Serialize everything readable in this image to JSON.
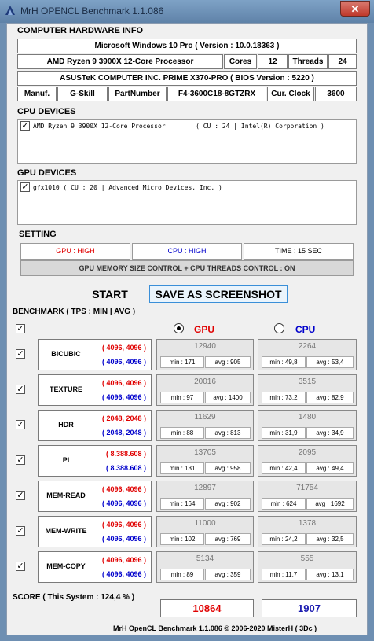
{
  "window": {
    "title": "MrH OPENCL Benchmark 1.1.086",
    "close_glyph": "✕"
  },
  "hardware": {
    "header": "COMPUTER HARDWARE INFO",
    "os": "Microsoft Windows 10 Pro ( Version : 10.0.18363 )",
    "cpu": "AMD Ryzen 9 3900X 12-Core Processor",
    "cores_label": "Cores",
    "cores_value": "12",
    "threads_label": "Threads",
    "threads_value": "24",
    "board": "ASUSTeK COMPUTER INC. PRIME X370-PRO ( BIOS Version : 5220 )",
    "manuf_label": "Manuf.",
    "manuf_value": "G-Skill",
    "part_label": "PartNumber",
    "part_value": "F4-3600C18-8GTZRX",
    "clock_label": "Cur. Clock",
    "clock_value": "3600"
  },
  "cpu_devices": {
    "header": "CPU DEVICES",
    "items": [
      "AMD Ryzen 9 3900X 12-Core Processor        ( CU : 24 | Intel(R) Corporation )"
    ]
  },
  "gpu_devices": {
    "header": "GPU DEVICES",
    "items": [
      "gfx1010 ( CU : 20 | Advanced Micro Devices, Inc. )"
    ]
  },
  "setting": {
    "header": "SETTING",
    "gpu": "GPU : HIGH",
    "cpu": "CPU : HIGH",
    "time": "TIME : 15 SEC",
    "memory": "GPU MEMORY SIZE CONTROL + CPU THREADS CONTROL : ON"
  },
  "buttons": {
    "start": "START",
    "save": "SAVE AS SCREENSHOT"
  },
  "benchmark": {
    "header": "BENCHMARK ( TPS : MIN | AVG )",
    "gpu_label": "GPU",
    "cpu_label": "CPU",
    "rows": [
      {
        "name": "BICUBIC",
        "gpu_size": "( 4096, 4096 )",
        "cpu_size": "( 4096, 4096 )",
        "gpu_val": "12940",
        "gpu_min": "min : 171",
        "gpu_avg": "avg : 905",
        "cpu_val": "2264",
        "cpu_min": "min : 49,8",
        "cpu_avg": "avg : 53,4"
      },
      {
        "name": "TEXTURE",
        "gpu_size": "( 4096, 4096 )",
        "cpu_size": "( 4096, 4096 )",
        "gpu_val": "20016",
        "gpu_min": "min : 97",
        "gpu_avg": "avg : 1400",
        "cpu_val": "3515",
        "cpu_min": "min : 73,2",
        "cpu_avg": "avg : 82,9"
      },
      {
        "name": "HDR",
        "gpu_size": "( 2048, 2048 )",
        "cpu_size": "( 2048, 2048 )",
        "gpu_val": "11629",
        "gpu_min": "min : 88",
        "gpu_avg": "avg : 813",
        "cpu_val": "1480",
        "cpu_min": "min : 31,9",
        "cpu_avg": "avg : 34,9"
      },
      {
        "name": "PI",
        "gpu_size": "( 8.388.608 )",
        "cpu_size": "( 8.388.608 )",
        "gpu_val": "13705",
        "gpu_min": "min : 131",
        "gpu_avg": "avg : 958",
        "cpu_val": "2095",
        "cpu_min": "min : 42,4",
        "cpu_avg": "avg : 49,4"
      },
      {
        "name": "MEM-READ",
        "gpu_size": "( 4096, 4096 )",
        "cpu_size": "( 4096, 4096 )",
        "gpu_val": "12897",
        "gpu_min": "min : 164",
        "gpu_avg": "avg : 902",
        "cpu_val": "71754",
        "cpu_min": "min : 624",
        "cpu_avg": "avg : 1692"
      },
      {
        "name": "MEM-WRITE",
        "gpu_size": "( 4096, 4096 )",
        "cpu_size": "( 4096, 4096 )",
        "gpu_val": "11000",
        "gpu_min": "min : 102",
        "gpu_avg": "avg : 769",
        "cpu_val": "1378",
        "cpu_min": "min : 24,2",
        "cpu_avg": "avg : 32,5"
      },
      {
        "name": "MEM-COPY",
        "gpu_size": "( 4096, 4096 )",
        "cpu_size": "( 4096, 4096 )",
        "gpu_val": "5134",
        "gpu_min": "min : 89",
        "gpu_avg": "avg : 359",
        "cpu_val": "555",
        "cpu_min": "min : 11,7",
        "cpu_avg": "avg : 13,1"
      }
    ]
  },
  "score": {
    "label": "SCORE ( This System : 124,4 % )",
    "gpu": "10864",
    "cpu": "1907"
  },
  "footer": "MrH OpenCL Benchmark 1.1.086  ©  2006-2020 MisterH ( 3Dc )",
  "colors": {
    "gpu": "#e00000",
    "cpu": "#0000cc",
    "save_border": "#3a8fd8",
    "title_bar": "#6f92b8"
  }
}
